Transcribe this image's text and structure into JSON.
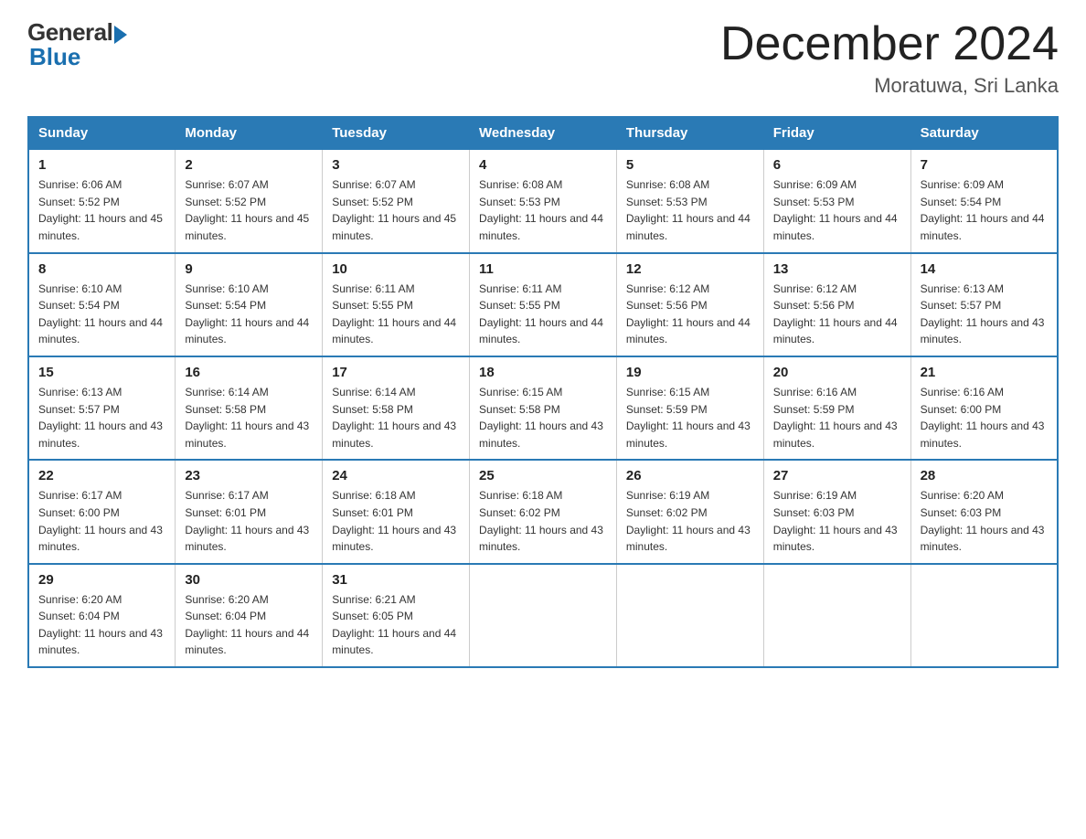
{
  "header": {
    "logo_general": "General",
    "logo_blue": "Blue",
    "title": "December 2024",
    "location": "Moratuwa, Sri Lanka"
  },
  "days_of_week": [
    "Sunday",
    "Monday",
    "Tuesday",
    "Wednesday",
    "Thursday",
    "Friday",
    "Saturday"
  ],
  "weeks": [
    [
      {
        "day": "1",
        "sunrise": "6:06 AM",
        "sunset": "5:52 PM",
        "daylight": "11 hours and 45 minutes."
      },
      {
        "day": "2",
        "sunrise": "6:07 AM",
        "sunset": "5:52 PM",
        "daylight": "11 hours and 45 minutes."
      },
      {
        "day": "3",
        "sunrise": "6:07 AM",
        "sunset": "5:52 PM",
        "daylight": "11 hours and 45 minutes."
      },
      {
        "day": "4",
        "sunrise": "6:08 AM",
        "sunset": "5:53 PM",
        "daylight": "11 hours and 44 minutes."
      },
      {
        "day": "5",
        "sunrise": "6:08 AM",
        "sunset": "5:53 PM",
        "daylight": "11 hours and 44 minutes."
      },
      {
        "day": "6",
        "sunrise": "6:09 AM",
        "sunset": "5:53 PM",
        "daylight": "11 hours and 44 minutes."
      },
      {
        "day": "7",
        "sunrise": "6:09 AM",
        "sunset": "5:54 PM",
        "daylight": "11 hours and 44 minutes."
      }
    ],
    [
      {
        "day": "8",
        "sunrise": "6:10 AM",
        "sunset": "5:54 PM",
        "daylight": "11 hours and 44 minutes."
      },
      {
        "day": "9",
        "sunrise": "6:10 AM",
        "sunset": "5:54 PM",
        "daylight": "11 hours and 44 minutes."
      },
      {
        "day": "10",
        "sunrise": "6:11 AM",
        "sunset": "5:55 PM",
        "daylight": "11 hours and 44 minutes."
      },
      {
        "day": "11",
        "sunrise": "6:11 AM",
        "sunset": "5:55 PM",
        "daylight": "11 hours and 44 minutes."
      },
      {
        "day": "12",
        "sunrise": "6:12 AM",
        "sunset": "5:56 PM",
        "daylight": "11 hours and 44 minutes."
      },
      {
        "day": "13",
        "sunrise": "6:12 AM",
        "sunset": "5:56 PM",
        "daylight": "11 hours and 44 minutes."
      },
      {
        "day": "14",
        "sunrise": "6:13 AM",
        "sunset": "5:57 PM",
        "daylight": "11 hours and 43 minutes."
      }
    ],
    [
      {
        "day": "15",
        "sunrise": "6:13 AM",
        "sunset": "5:57 PM",
        "daylight": "11 hours and 43 minutes."
      },
      {
        "day": "16",
        "sunrise": "6:14 AM",
        "sunset": "5:58 PM",
        "daylight": "11 hours and 43 minutes."
      },
      {
        "day": "17",
        "sunrise": "6:14 AM",
        "sunset": "5:58 PM",
        "daylight": "11 hours and 43 minutes."
      },
      {
        "day": "18",
        "sunrise": "6:15 AM",
        "sunset": "5:58 PM",
        "daylight": "11 hours and 43 minutes."
      },
      {
        "day": "19",
        "sunrise": "6:15 AM",
        "sunset": "5:59 PM",
        "daylight": "11 hours and 43 minutes."
      },
      {
        "day": "20",
        "sunrise": "6:16 AM",
        "sunset": "5:59 PM",
        "daylight": "11 hours and 43 minutes."
      },
      {
        "day": "21",
        "sunrise": "6:16 AM",
        "sunset": "6:00 PM",
        "daylight": "11 hours and 43 minutes."
      }
    ],
    [
      {
        "day": "22",
        "sunrise": "6:17 AM",
        "sunset": "6:00 PM",
        "daylight": "11 hours and 43 minutes."
      },
      {
        "day": "23",
        "sunrise": "6:17 AM",
        "sunset": "6:01 PM",
        "daylight": "11 hours and 43 minutes."
      },
      {
        "day": "24",
        "sunrise": "6:18 AM",
        "sunset": "6:01 PM",
        "daylight": "11 hours and 43 minutes."
      },
      {
        "day": "25",
        "sunrise": "6:18 AM",
        "sunset": "6:02 PM",
        "daylight": "11 hours and 43 minutes."
      },
      {
        "day": "26",
        "sunrise": "6:19 AM",
        "sunset": "6:02 PM",
        "daylight": "11 hours and 43 minutes."
      },
      {
        "day": "27",
        "sunrise": "6:19 AM",
        "sunset": "6:03 PM",
        "daylight": "11 hours and 43 minutes."
      },
      {
        "day": "28",
        "sunrise": "6:20 AM",
        "sunset": "6:03 PM",
        "daylight": "11 hours and 43 minutes."
      }
    ],
    [
      {
        "day": "29",
        "sunrise": "6:20 AM",
        "sunset": "6:04 PM",
        "daylight": "11 hours and 43 minutes."
      },
      {
        "day": "30",
        "sunrise": "6:20 AM",
        "sunset": "6:04 PM",
        "daylight": "11 hours and 44 minutes."
      },
      {
        "day": "31",
        "sunrise": "6:21 AM",
        "sunset": "6:05 PM",
        "daylight": "11 hours and 44 minutes."
      },
      null,
      null,
      null,
      null
    ]
  ]
}
